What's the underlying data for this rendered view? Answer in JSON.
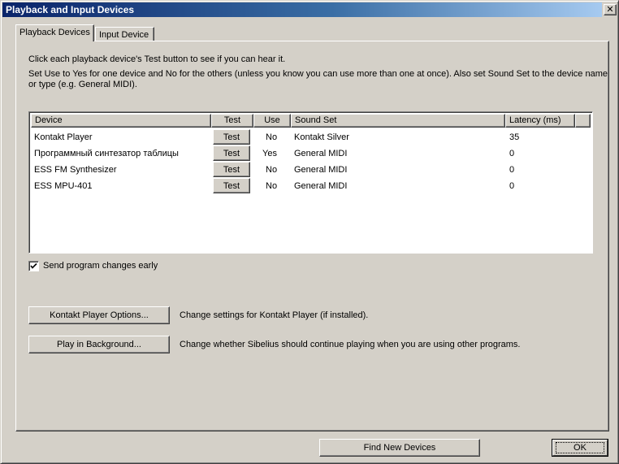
{
  "window": {
    "title": "Playback and Input Devices",
    "close_glyph": "✕"
  },
  "tabs": [
    {
      "label": "Playback Devices",
      "active": true
    },
    {
      "label": "Input Device",
      "active": false
    }
  ],
  "instructions": {
    "line1": "Click each playback device's Test button to see if you can hear it.",
    "line2a": "Set Use to Yes for one device and No for the others (unless you know you can use more than one at once). Also set Sound Set to the device name",
    "line2b": "or type (e.g. General MIDI)."
  },
  "devices_table": {
    "columns": [
      "Device",
      "Test",
      "Use",
      "Sound Set",
      "Latency (ms)"
    ],
    "rows": [
      {
        "device": "Kontakt Player",
        "test": "Test",
        "use": "No",
        "sound_set": "Kontakt Silver",
        "latency": "35"
      },
      {
        "device": "Программный синтезатор таблицы",
        "test": "Test",
        "use": "Yes",
        "sound_set": "General MIDI",
        "latency": "0"
      },
      {
        "device": "ESS FM Synthesizer",
        "test": "Test",
        "use": "No",
        "sound_set": "General MIDI",
        "latency": "0"
      },
      {
        "device": "ESS MPU-401",
        "test": "Test",
        "use": "No",
        "sound_set": "General MIDI",
        "latency": "0"
      }
    ]
  },
  "send_program_changes": {
    "label": "Send program changes early",
    "checked": true
  },
  "options": {
    "kontakt_button": "Kontakt Player Options...",
    "kontakt_desc": "Change settings for Kontakt Player (if installed).",
    "background_button": "Play in Background...",
    "background_desc": "Change whether Sibelius should continue playing when you are using other programs."
  },
  "footer": {
    "find_button": "Find New Devices",
    "ok_button": "OK"
  },
  "colors": {
    "face": "#d4d0c8",
    "title_start": "#0a246a",
    "title_end": "#a6caf0",
    "list_bg": "#ffffff"
  }
}
